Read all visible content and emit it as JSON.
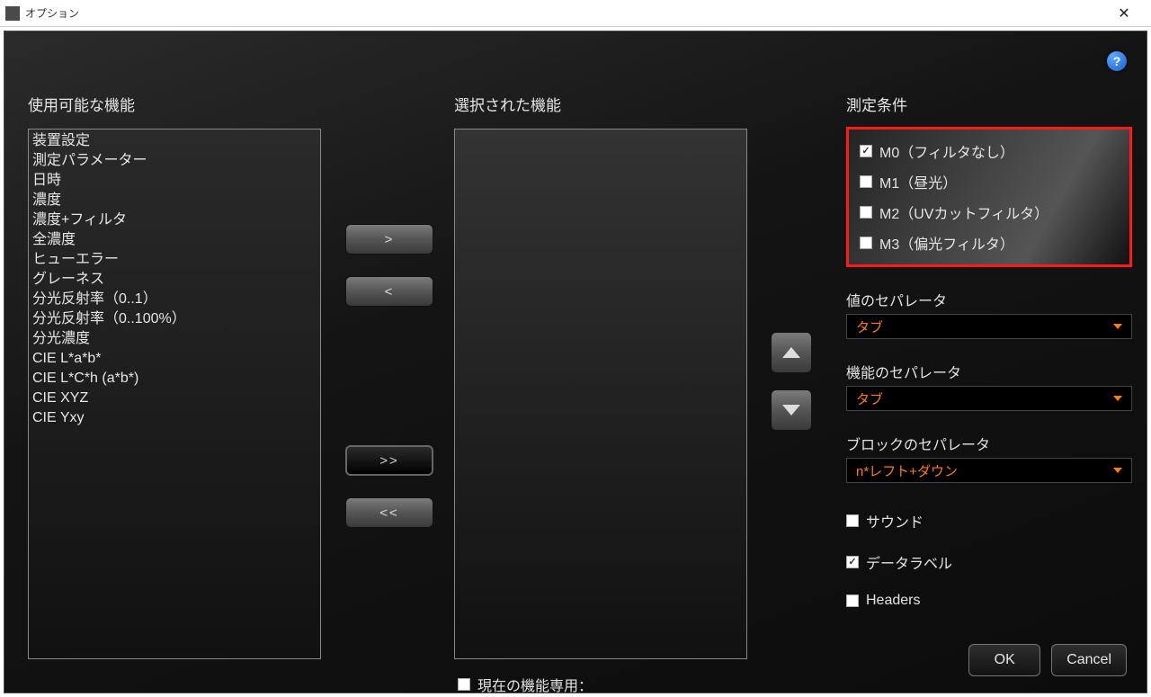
{
  "window": {
    "title": "オプション"
  },
  "sections": {
    "available": "使用可能な機能",
    "selected": "選択された機能",
    "measurement": "測定条件"
  },
  "available_items": [
    "装置設定",
    "測定パラメーター",
    "日時",
    "濃度",
    "濃度+フィルタ",
    "全濃度",
    "ヒューエラー",
    "グレーネス",
    "分光反射率（0..1）",
    "分光反射率（0..100%）",
    "分光濃度",
    "CIE L*a*b*",
    "CIE L*C*h (a*b*)",
    "CIE XYZ",
    "CIE Yxy"
  ],
  "transfer": {
    "add": ">",
    "remove": "<",
    "add_all": ">>",
    "remove_all": "<<"
  },
  "measurement": {
    "m0": {
      "checked": true,
      "label": "M0（フィルタなし）"
    },
    "m1": {
      "checked": false,
      "label": "M1（昼光）"
    },
    "m2": {
      "checked": false,
      "label": "M2（UVカットフィルタ）"
    },
    "m3": {
      "checked": false,
      "label": "M3（偏光フィルタ）"
    }
  },
  "separators": {
    "value_label": "値のセパレータ",
    "value_selected": "タブ",
    "function_label": "機能のセパレータ",
    "function_selected": "タブ",
    "block_label": "ブロックのセパレータ",
    "block_selected": "n*レフト+ダウン"
  },
  "options": {
    "sound": {
      "checked": false,
      "label": "サウンド"
    },
    "data_label": {
      "checked": true,
      "label": "データラベル"
    },
    "headers": {
      "checked": false,
      "label": "Headers"
    }
  },
  "bottom": {
    "current_only": "現在の機能専用：",
    "ok": "OK",
    "cancel": "Cancel"
  },
  "icons": {
    "help": "?"
  }
}
